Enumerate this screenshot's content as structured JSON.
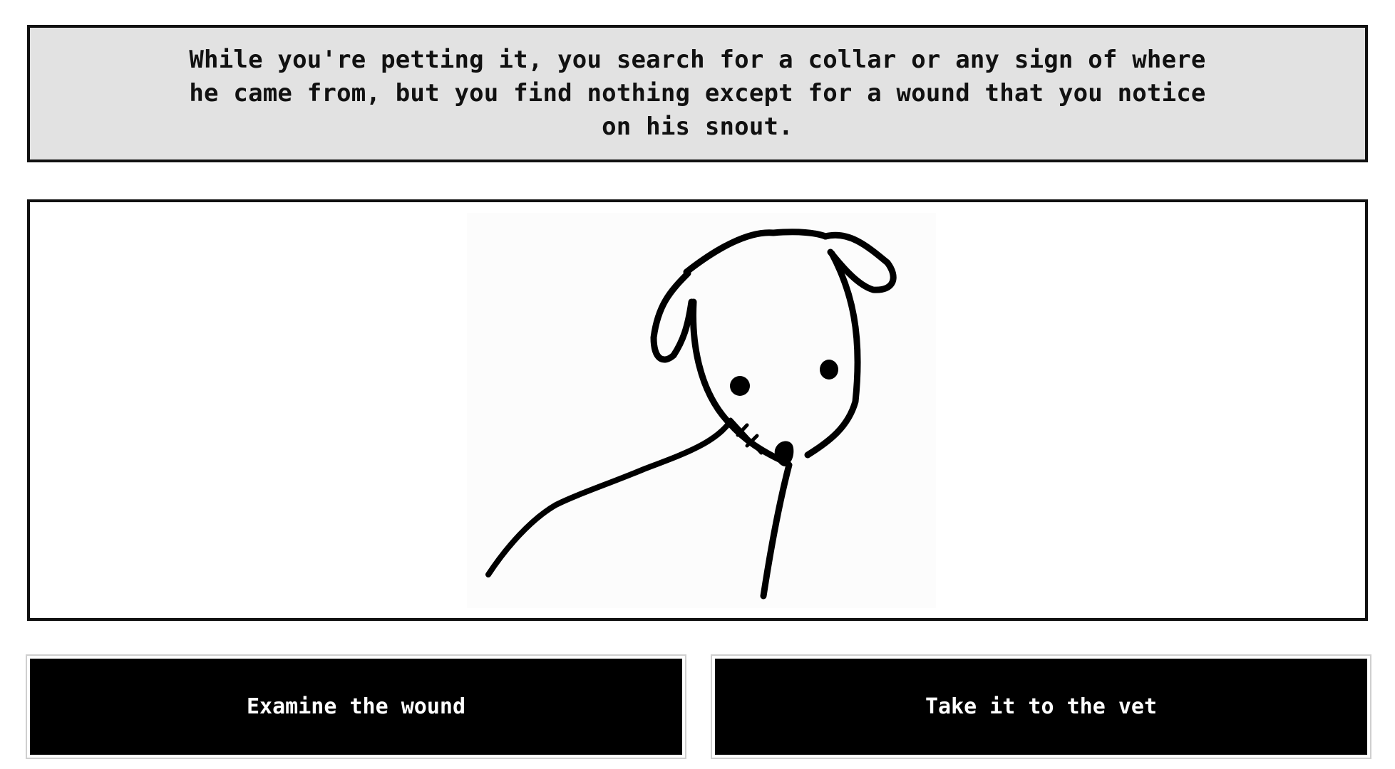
{
  "narration": {
    "text": "While you're petting it, you search for a collar or any sign of where he came from, but you find nothing except for a wound that you notice on his snout."
  },
  "scene": {
    "illustration": "dog-sketch-with-stitched-snout"
  },
  "choices": [
    {
      "label": "Examine the wound"
    },
    {
      "label": "Take it to the vet"
    }
  ],
  "colors": {
    "narration_background": "#e2e2e2",
    "border": "#111111",
    "button_background": "#000000",
    "button_text": "#ffffff"
  }
}
